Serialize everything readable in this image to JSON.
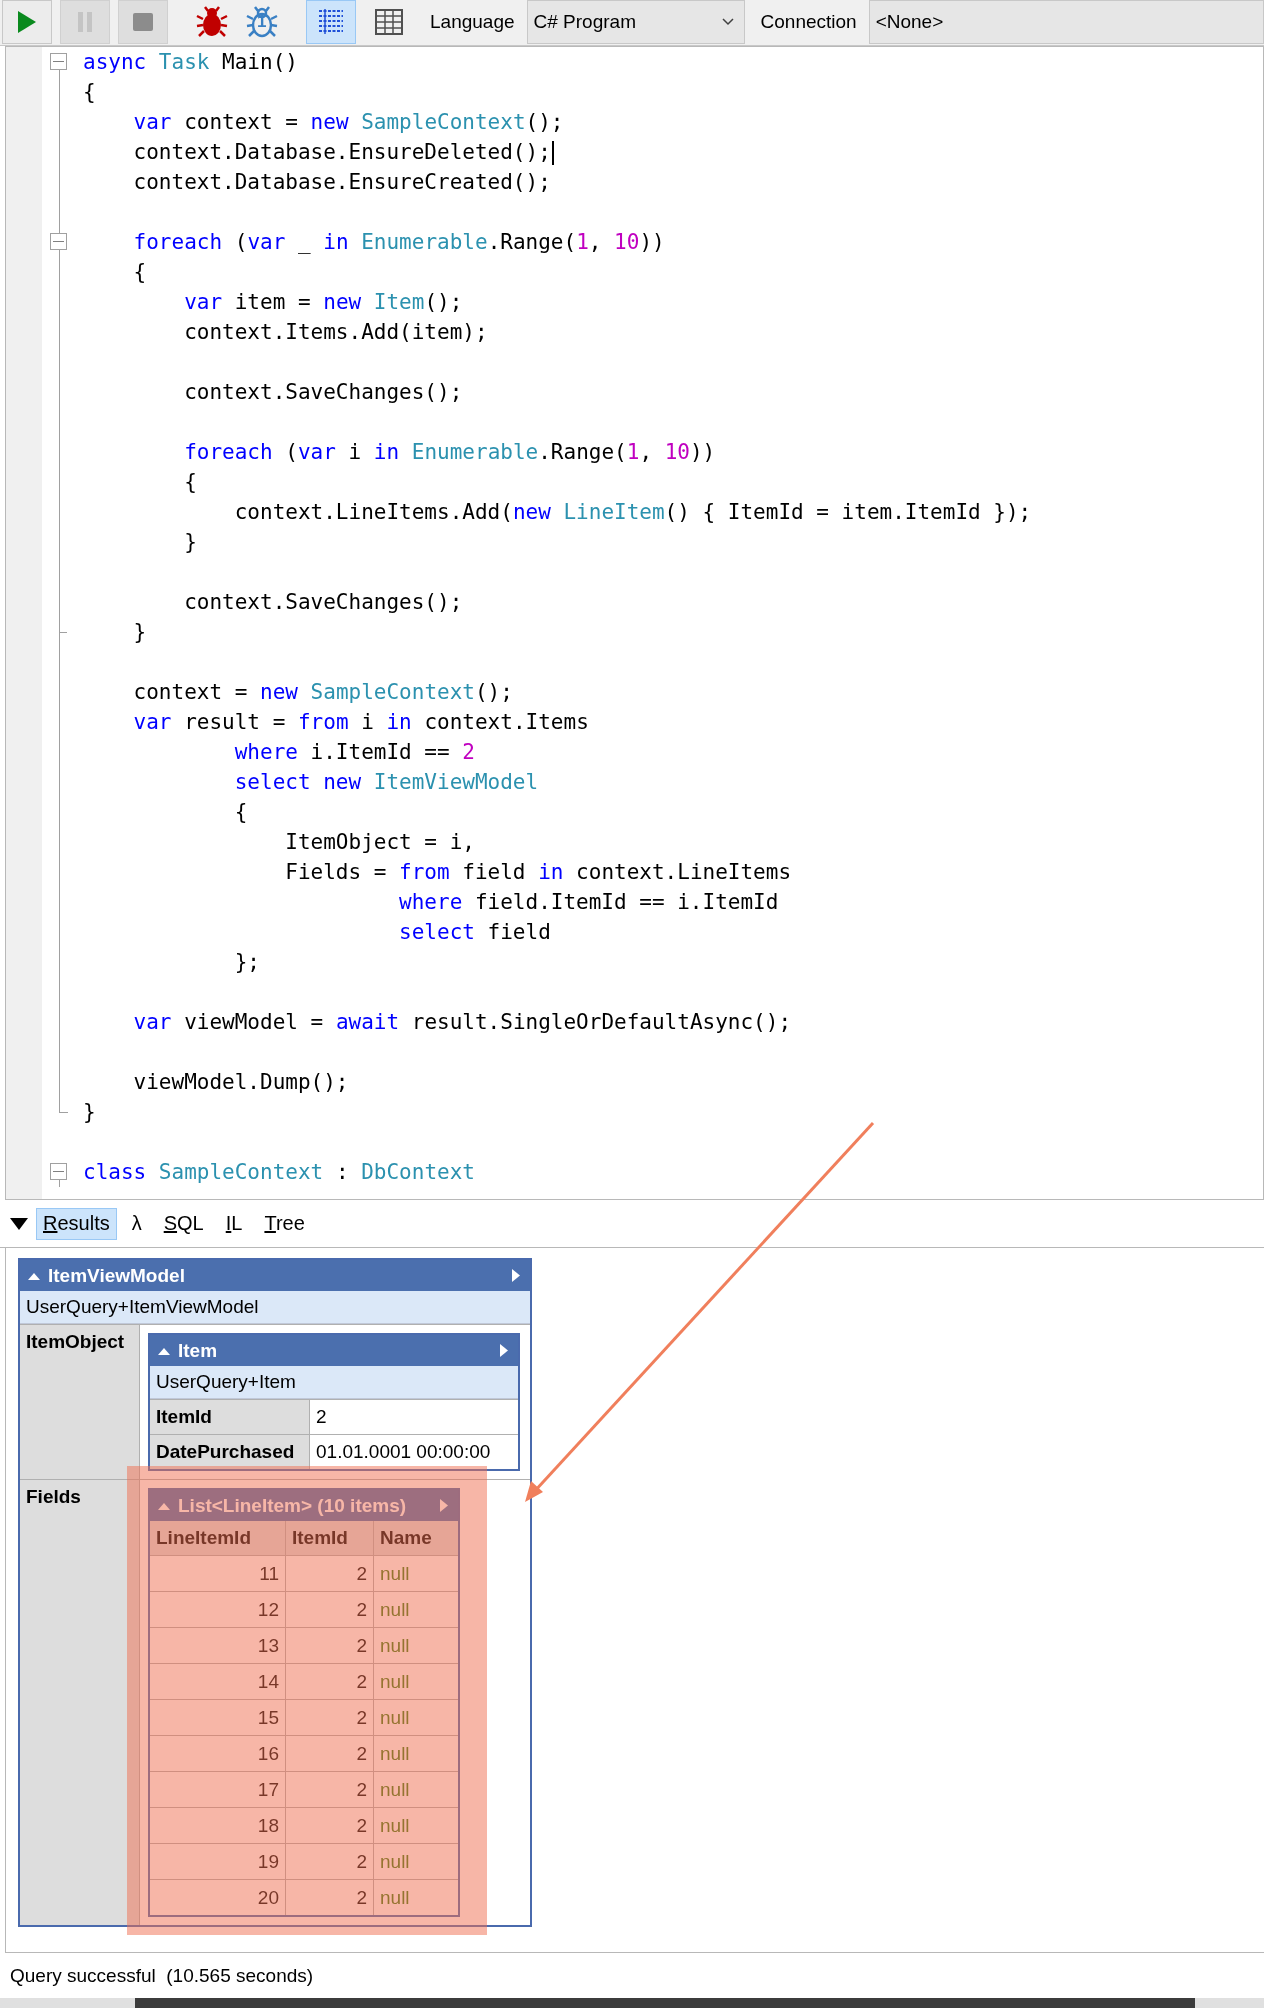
{
  "toolbar": {
    "run_buttons": [
      {
        "kind": "run",
        "disabled": false
      },
      {
        "kind": "pause",
        "disabled": true
      },
      {
        "kind": "stop",
        "disabled": true
      }
    ],
    "debug_buttons": [
      {
        "kind": "bug"
      },
      {
        "kind": "step",
        "badge": "1"
      }
    ],
    "view_buttons": [
      {
        "kind": "rich-text",
        "selected": true
      },
      {
        "kind": "grid",
        "selected": false
      }
    ],
    "language_label": "Language",
    "language": "C# Program",
    "connection_label": "Connection",
    "connection": "<None>"
  },
  "code": {
    "lines": [
      {
        "fold": true,
        "guide": false,
        "tokens": [
          {
            "t": "async",
            "color": "#0000ff"
          },
          {
            "t": " Task",
            "color": "#2b91af"
          },
          {
            "t": " Main()"
          }
        ]
      },
      {
        "guide": true,
        "tokens": [
          {
            "t": "{"
          }
        ]
      },
      {
        "guide": true,
        "tokens": [
          {
            "t": "    var",
            "color": "#0000ff"
          },
          {
            "t": " context = "
          },
          {
            "t": "new",
            "color": "#0000ff"
          },
          {
            "t": " SampleContext",
            "color": "#2b91af"
          },
          {
            "t": "();"
          }
        ]
      },
      {
        "guide": true,
        "caret": true,
        "tokens": [
          {
            "t": "    context.Database.EnsureDeleted();"
          }
        ]
      },
      {
        "guide": true,
        "tokens": [
          {
            "t": "    context.Database.EnsureCreated();"
          }
        ]
      },
      {
        "guide": true
      },
      {
        "fold": true,
        "guide": true,
        "tokens": [
          {
            "t": "    foreach",
            "color": "#0000ff"
          },
          {
            "t": " ("
          },
          {
            "t": "var",
            "color": "#0000ff"
          },
          {
            "t": " _ "
          },
          {
            "t": "in",
            "color": "#0000ff"
          },
          {
            "t": " Enumerable",
            "color": "#2b91af"
          },
          {
            "t": ".Range("
          },
          {
            "t": "1",
            "color": "#c000c0"
          },
          {
            "t": ", "
          },
          {
            "t": "10",
            "color": "#c000c0"
          },
          {
            "t": "))"
          }
        ]
      },
      {
        "guide": true,
        "tokens": [
          {
            "t": "    {"
          }
        ]
      },
      {
        "guide": true,
        "tokens": [
          {
            "t": "        var",
            "color": "#0000ff"
          },
          {
            "t": " item = "
          },
          {
            "t": "new",
            "color": "#0000ff"
          },
          {
            "t": " Item",
            "color": "#2b91af"
          },
          {
            "t": "();"
          }
        ]
      },
      {
        "guide": true,
        "tokens": [
          {
            "t": "        context.Items.Add(item);"
          }
        ]
      },
      {
        "guide": true
      },
      {
        "guide": true,
        "tokens": [
          {
            "t": "        context.SaveChanges();"
          }
        ]
      },
      {
        "guide": true
      },
      {
        "guide": true,
        "tokens": [
          {
            "t": "        foreach",
            "color": "#0000ff"
          },
          {
            "t": " ("
          },
          {
            "t": "var",
            "color": "#0000ff"
          },
          {
            "t": " i "
          },
          {
            "t": "in",
            "color": "#0000ff"
          },
          {
            "t": " Enumerable",
            "color": "#2b91af"
          },
          {
            "t": ".Range("
          },
          {
            "t": "1",
            "color": "#c000c0"
          },
          {
            "t": ", "
          },
          {
            "t": "10",
            "color": "#c000c0"
          },
          {
            "t": "))"
          }
        ]
      },
      {
        "guide": true,
        "tokens": [
          {
            "t": "        {"
          }
        ]
      },
      {
        "guide": true,
        "tokens": [
          {
            "t": "            context.LineItems.Add("
          },
          {
            "t": "new",
            "color": "#0000ff"
          },
          {
            "t": " LineItem",
            "color": "#2b91af"
          },
          {
            "t": "() { ItemId = item.ItemId });"
          }
        ]
      },
      {
        "guide": true,
        "tokens": [
          {
            "t": "        }"
          }
        ]
      },
      {
        "guide": true
      },
      {
        "guide": true,
        "tokens": [
          {
            "t": "        context.SaveChanges();"
          }
        ]
      },
      {
        "fold_end": true,
        "guide": true,
        "tokens": [
          {
            "t": "    }"
          }
        ]
      },
      {
        "guide": true
      },
      {
        "guide": true,
        "tokens": [
          {
            "t": "    context = "
          },
          {
            "t": "new",
            "color": "#0000ff"
          },
          {
            "t": " SampleContext",
            "color": "#2b91af"
          },
          {
            "t": "();"
          }
        ]
      },
      {
        "guide": true,
        "tokens": [
          {
            "t": "    var",
            "color": "#0000ff"
          },
          {
            "t": " result = "
          },
          {
            "t": "from",
            "color": "#0000ff"
          },
          {
            "t": " i "
          },
          {
            "t": "in",
            "color": "#0000ff"
          },
          {
            "t": " context.Items"
          }
        ]
      },
      {
        "guide": true,
        "tokens": [
          {
            "t": "            where",
            "color": "#0000ff"
          },
          {
            "t": " i.ItemId == "
          },
          {
            "t": "2",
            "color": "#c000c0"
          }
        ]
      },
      {
        "guide": true,
        "tokens": [
          {
            "t": "            select",
            "color": "#0000ff"
          },
          {
            "t": " new",
            "color": "#0000ff"
          },
          {
            "t": " ItemViewModel",
            "color": "#2b91af"
          }
        ]
      },
      {
        "guide": true,
        "tokens": [
          {
            "t": "            {"
          }
        ]
      },
      {
        "guide": true,
        "tokens": [
          {
            "t": "                ItemObject = i,"
          }
        ]
      },
      {
        "guide": true,
        "tokens": [
          {
            "t": "                Fields = "
          },
          {
            "t": "from",
            "color": "#0000ff"
          },
          {
            "t": " field "
          },
          {
            "t": "in",
            "color": "#0000ff"
          },
          {
            "t": " context.LineItems"
          }
        ]
      },
      {
        "guide": true,
        "tokens": [
          {
            "t": "                         where",
            "color": "#0000ff"
          },
          {
            "t": " field.ItemId == i.ItemId"
          }
        ]
      },
      {
        "guide": true,
        "tokens": [
          {
            "t": "                         select",
            "color": "#0000ff"
          },
          {
            "t": " field"
          }
        ]
      },
      {
        "guide": true,
        "tokens": [
          {
            "t": "            };"
          }
        ]
      },
      {
        "guide": true
      },
      {
        "guide": true,
        "tokens": [
          {
            "t": "    var",
            "color": "#0000ff"
          },
          {
            "t": " viewModel = "
          },
          {
            "t": "await",
            "color": "#0000ff"
          },
          {
            "t": " result.SingleOrDefaultAsync();"
          }
        ]
      },
      {
        "guide": true
      },
      {
        "guide": true,
        "tokens": [
          {
            "t": "    viewModel.Dump();"
          }
        ]
      },
      {
        "fold_end": true,
        "guide": false,
        "tokens": [
          {
            "t": "}"
          }
        ]
      },
      {
        "guide": false
      },
      {
        "fold": true,
        "guide": false,
        "tokens": [
          {
            "t": "class",
            "color": "#0000ff"
          },
          {
            "t": " SampleContext",
            "color": "#2b91af"
          },
          {
            "t": " : "
          },
          {
            "t": "DbContext",
            "color": "#2b91af"
          }
        ]
      }
    ]
  },
  "result_tabs": [
    {
      "label": "Results",
      "kind": "text",
      "selected": true
    },
    {
      "label": "λ",
      "kind": "symbol",
      "selected": false
    },
    {
      "label": "SQL",
      "kind": "text",
      "selected": false
    },
    {
      "label": "IL",
      "kind": "text",
      "selected": false
    },
    {
      "label": "Tree",
      "kind": "text",
      "selected": false
    }
  ],
  "result": {
    "title": "ItemViewModel",
    "type": "UserQuery+ItemViewModel",
    "members": [
      {
        "name": "ItemObject",
        "kind": "object",
        "value": {
          "title": "Item",
          "type": "UserQuery+Item",
          "members": [
            {
              "name": "ItemId",
              "value": "2"
            },
            {
              "name": "DatePurchased",
              "value": "01.01.0001 00:00:00"
            }
          ]
        }
      },
      {
        "name": "Fields",
        "kind": "list",
        "highlighted": true,
        "value": {
          "title": "List<LineItem> (10 items)",
          "columns": [
            {
              "label": "LineItemId",
              "kind": "number"
            },
            {
              "label": "ItemId",
              "kind": "number"
            },
            {
              "label": "Name",
              "kind": "null"
            }
          ],
          "rows": [
            [
              "11",
              "2",
              "null"
            ],
            [
              "12",
              "2",
              "null"
            ],
            [
              "13",
              "2",
              "null"
            ],
            [
              "14",
              "2",
              "null"
            ],
            [
              "15",
              "2",
              "null"
            ],
            [
              "16",
              "2",
              "null"
            ],
            [
              "17",
              "2",
              "null"
            ],
            [
              "18",
              "2",
              "null"
            ],
            [
              "19",
              "2",
              "null"
            ],
            [
              "20",
              "2",
              "null"
            ]
          ]
        }
      }
    ]
  },
  "status": "Query successful  (10.565 seconds)"
}
